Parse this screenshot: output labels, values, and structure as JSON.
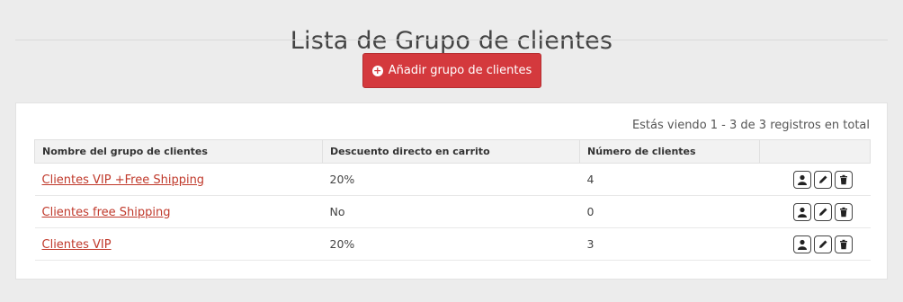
{
  "page": {
    "title": "Lista de Grupo de clientes",
    "add_button": "Añadir grupo de clientes"
  },
  "panel": {
    "info": "Estás viendo 1 - 3 de 3 registros en total",
    "columns": [
      "Nombre del grupo de clientes",
      "Descuento directo en carrito",
      "Número de clientes",
      ""
    ],
    "rows": [
      {
        "name": "Clientes VIP +Free Shipping",
        "discount": "20%",
        "count": "4"
      },
      {
        "name": "Clientes free Shipping",
        "discount": "No",
        "count": "0"
      },
      {
        "name": "Clientes VIP",
        "discount": "20%",
        "count": "3"
      }
    ],
    "row_actions": [
      "user-icon",
      "pencil-icon",
      "trash-icon"
    ]
  },
  "colors": {
    "accent": "#d4393d",
    "link": "#c0392b"
  }
}
